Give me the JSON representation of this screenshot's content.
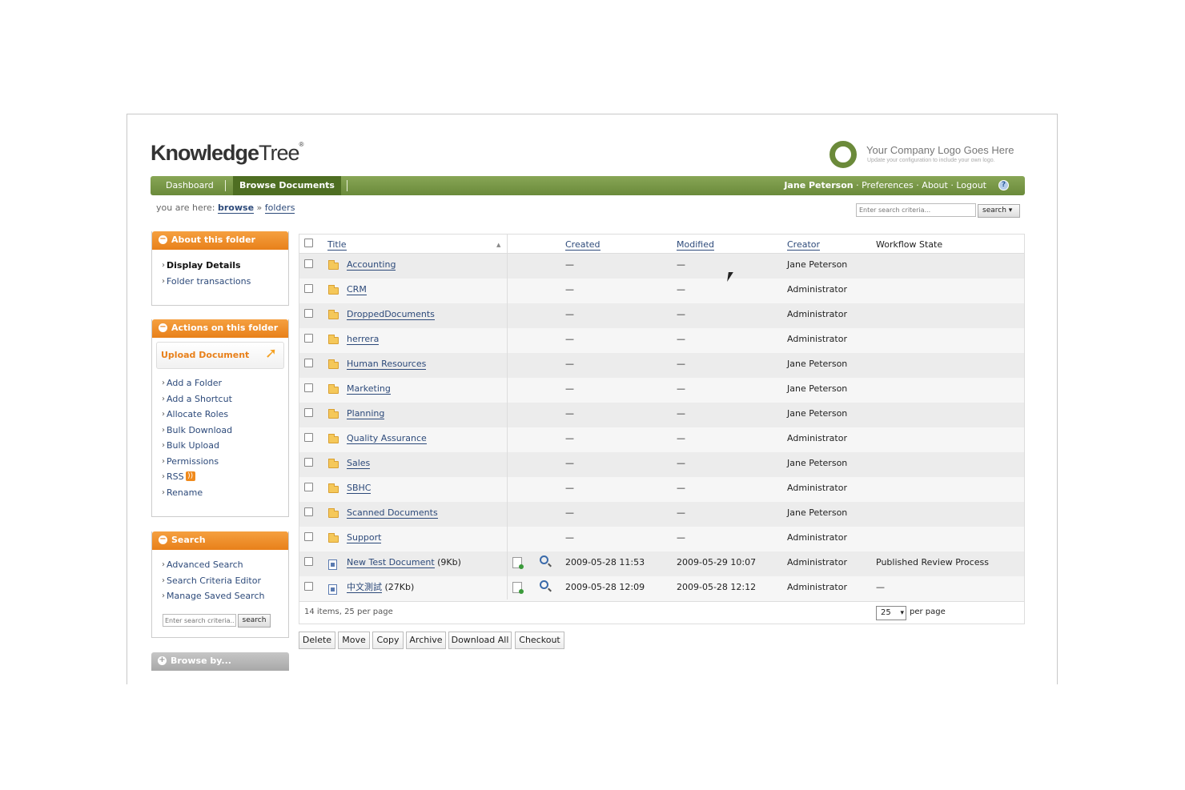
{
  "app": {
    "logo_bold": "Knowledge",
    "logo_thin": "Tree",
    "logo_mark": "®",
    "company_logo_line1": "Your Company Logo Goes Here",
    "company_logo_line2": "Update your configuration to include your own logo."
  },
  "nav": {
    "items": [
      {
        "label": "Dashboard",
        "active": false
      },
      {
        "label": "Browse Documents",
        "active": true
      }
    ],
    "user": "Jane Peterson",
    "links": [
      "Preferences",
      "About",
      "Logout"
    ],
    "separator": " · ",
    "help_icon": "help-icon"
  },
  "breadcrumb": {
    "prefix": "you are here:",
    "items": [
      "browse",
      "folders"
    ],
    "separator": "»"
  },
  "top_search": {
    "placeholder": "Enter search criteria...",
    "button": "search ▾"
  },
  "sidebar": {
    "about": {
      "title": "About this folder",
      "links": [
        "Display Details",
        "Folder transactions"
      ]
    },
    "actions": {
      "title": "Actions on this folder",
      "upload": "Upload Document",
      "links": [
        "Add a Folder",
        "Add a Shortcut",
        "Allocate Roles",
        "Bulk Download",
        "Bulk Upload",
        "Permissions",
        "RSS",
        "Rename"
      ]
    },
    "search": {
      "title": "Search",
      "links": [
        "Advanced Search",
        "Search Criteria Editor",
        "Manage Saved Search"
      ],
      "placeholder": "Enter search criteria...",
      "button": "search"
    },
    "browse_by": {
      "title": "Browse by..."
    }
  },
  "table": {
    "columns": [
      "Title",
      "Created",
      "Modified",
      "Creator",
      "Workflow State"
    ],
    "sort_indicator": "▲",
    "rows": [
      {
        "type": "folder",
        "title": "Accounting",
        "size": "",
        "created": "—",
        "modified": "—",
        "creator": "Jane Peterson",
        "workflow": ""
      },
      {
        "type": "folder",
        "title": "CRM",
        "size": "",
        "created": "—",
        "modified": "—",
        "creator": "Administrator",
        "workflow": ""
      },
      {
        "type": "folder",
        "title": "DroppedDocuments",
        "size": "",
        "created": "—",
        "modified": "—",
        "creator": "Administrator",
        "workflow": ""
      },
      {
        "type": "folder",
        "title": "herrera",
        "size": "",
        "created": "—",
        "modified": "—",
        "creator": "Administrator",
        "workflow": ""
      },
      {
        "type": "folder",
        "title": "Human Resources",
        "size": "",
        "created": "—",
        "modified": "—",
        "creator": "Jane Peterson",
        "workflow": ""
      },
      {
        "type": "folder",
        "title": "Marketing",
        "size": "",
        "created": "—",
        "modified": "—",
        "creator": "Jane Peterson",
        "workflow": ""
      },
      {
        "type": "folder",
        "title": "Planning",
        "size": "",
        "created": "—",
        "modified": "—",
        "creator": "Jane Peterson",
        "workflow": ""
      },
      {
        "type": "folder",
        "title": "Quality Assurance",
        "size": "",
        "created": "—",
        "modified": "—",
        "creator": "Administrator",
        "workflow": ""
      },
      {
        "type": "folder",
        "title": "Sales",
        "size": "",
        "created": "—",
        "modified": "—",
        "creator": "Jane Peterson",
        "workflow": ""
      },
      {
        "type": "folder",
        "title": "SBHC",
        "size": "",
        "created": "—",
        "modified": "—",
        "creator": "Administrator",
        "workflow": ""
      },
      {
        "type": "folder",
        "title": "Scanned Documents",
        "size": "",
        "created": "—",
        "modified": "—",
        "creator": "Jane Peterson",
        "workflow": ""
      },
      {
        "type": "folder",
        "title": "Support",
        "size": "",
        "created": "—",
        "modified": "—",
        "creator": "Administrator",
        "workflow": ""
      },
      {
        "type": "document",
        "title": "New Test Document",
        "size": "(9Kb)",
        "created": "2009-05-28 11:53",
        "modified": "2009-05-29 10:07",
        "creator": "Administrator",
        "workflow": "Published Review Process"
      },
      {
        "type": "document",
        "title": "中文測試",
        "size": "(27Kb)",
        "created": "2009-05-28 12:09",
        "modified": "2009-05-28 12:12",
        "creator": "Administrator",
        "workflow": "—"
      }
    ],
    "summary": "14 items, 25 per page",
    "per_page_value": "25",
    "per_page_label": "per page"
  },
  "actions": [
    "Delete",
    "Move",
    "Copy",
    "Archive",
    "Download All",
    "Checkout"
  ],
  "colors": {
    "nav_green": "#6a8a3a",
    "panel_orange": "#e8801a",
    "link_blue": "#2d4a7a"
  }
}
